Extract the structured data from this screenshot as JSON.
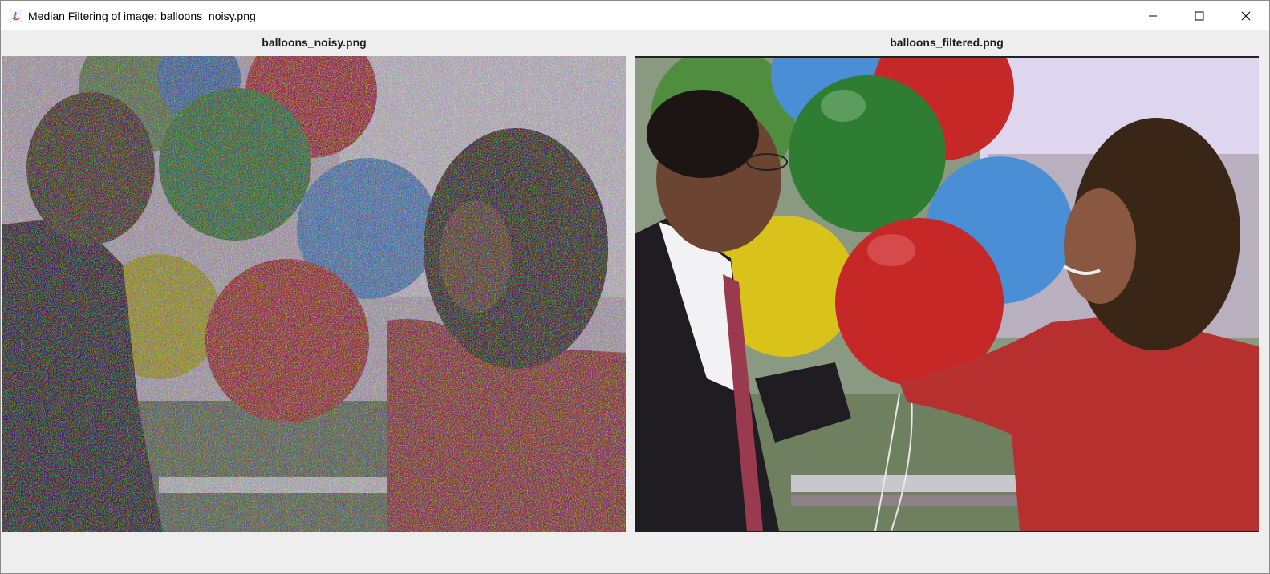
{
  "window": {
    "title": "Median Filtering of image: balloons_noisy.png"
  },
  "icons": {
    "app": "java-app-icon",
    "minimize": "minimize-icon",
    "maximize": "maximize-icon",
    "close": "close-icon"
  },
  "panes": {
    "left_label": "balloons_noisy.png",
    "right_label": "balloons_filtered.png"
  },
  "colors": {
    "red_balloon": "#c62828",
    "green_balloon": "#2e7d32",
    "blue_balloon": "#4a8fd6",
    "yellow_balloon": "#d9c21a",
    "sky": "#ddd6ee",
    "suit": "#1f1d22",
    "skin": "#7a4b34",
    "hair": "#3a2616",
    "blouse": "#b5302e"
  }
}
